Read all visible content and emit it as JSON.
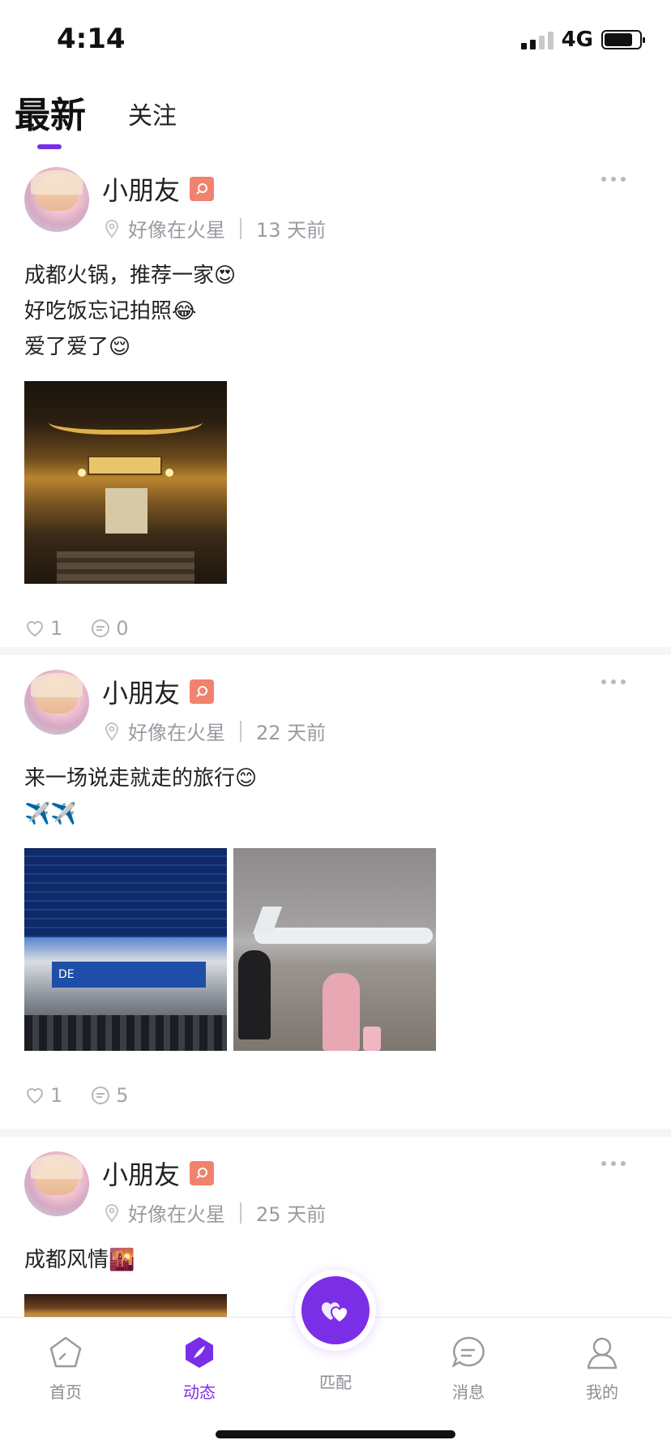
{
  "status_bar": {
    "time": "4:14",
    "network": "4G",
    "signal_bars": 4,
    "signal_active": 2,
    "battery_level": 0.8
  },
  "tabs": [
    {
      "label": "最新",
      "active": true
    },
    {
      "label": "关注",
      "active": false
    }
  ],
  "posts": [
    {
      "username": "小朋友",
      "location": "好像在火星",
      "time": "13 天前",
      "text": "成都火锅，推荐一家😍\n好吃饭忘记拍照😂\n爱了爱了😌",
      "likes": "1",
      "comments": "0",
      "photos": [
        "temple-night-photo"
      ]
    },
    {
      "username": "小朋友",
      "location": "好像在火星",
      "time": "22 天前",
      "text": "来一场说走就走的旅行😊\n✈️✈️",
      "likes": "1",
      "comments": "5",
      "photos": [
        "airport-security-photo",
        "airplane-tarmac-photo"
      ]
    },
    {
      "username": "小朋友",
      "location": "好像在火星",
      "time": "25 天前",
      "text": "成都风情🌇",
      "photos": [
        "chengdu-street-photo"
      ]
    }
  ],
  "bottom_nav": [
    {
      "label": "首页",
      "icon": "home-icon",
      "active": false
    },
    {
      "label": "动态",
      "icon": "feed-icon",
      "active": true
    },
    {
      "label": "匹配",
      "icon": "match-heart-icon",
      "active": false
    },
    {
      "label": "消息",
      "icon": "message-icon",
      "active": false
    },
    {
      "label": "我的",
      "icon": "profile-icon",
      "active": false
    }
  ],
  "colors": {
    "accent": "#7a2ee6",
    "badge": "#f0826e",
    "muted": "#9a9aa2"
  }
}
